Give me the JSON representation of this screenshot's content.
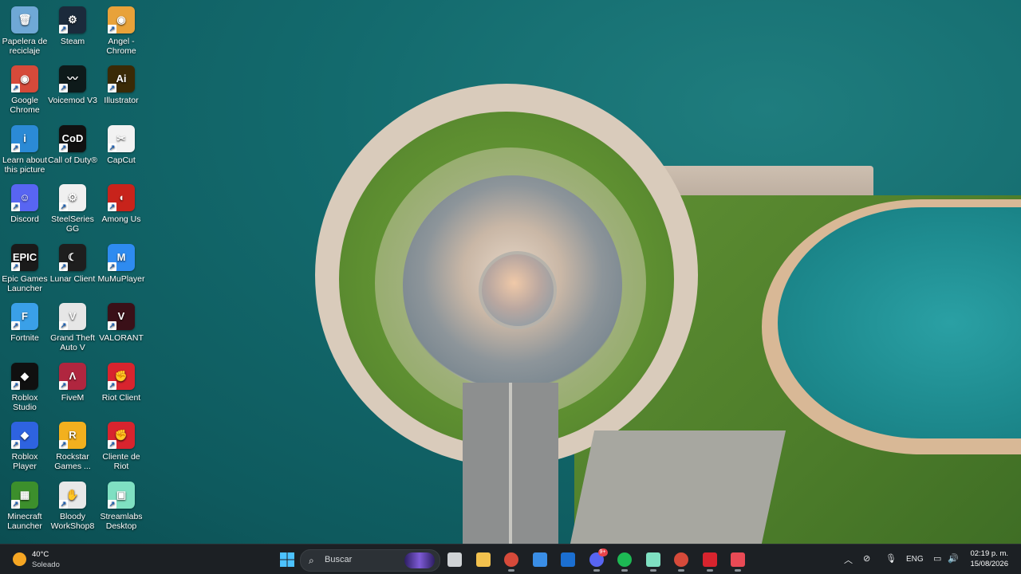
{
  "desktop": {
    "icons": [
      {
        "label": "Papelera de reciclaje",
        "glyph": "🗑",
        "color": "#6fa8d6"
      },
      {
        "label": "Steam",
        "glyph": "⚙",
        "color": "#1b2a3b"
      },
      {
        "label": "Angel - Chrome",
        "glyph": "◉",
        "color": "#e8a23a"
      },
      {
        "label": "Google Chrome",
        "glyph": "◉",
        "color": "#d64a3a"
      },
      {
        "label": "Voicemod V3",
        "glyph": "〰",
        "color": "#0e1a1a"
      },
      {
        "label": "Illustrator",
        "glyph": "Ai",
        "color": "#3a2a06"
      },
      {
        "label": "Learn about this picture",
        "glyph": "i",
        "color": "#2b8ad6"
      },
      {
        "label": "Call of Duty®",
        "glyph": "CoD",
        "color": "#111111"
      },
      {
        "label": "CapCut",
        "glyph": "✂",
        "color": "#f2f2f2"
      },
      {
        "label": "Discord",
        "glyph": "☺",
        "color": "#5865f2"
      },
      {
        "label": "SteelSeries GG",
        "glyph": "⚙",
        "color": "#f0f0f0"
      },
      {
        "label": "Among Us",
        "glyph": "◖",
        "color": "#c8231b"
      },
      {
        "label": "Epic Games Launcher",
        "glyph": "EPIC",
        "color": "#1a1a1a"
      },
      {
        "label": "Lunar Client",
        "glyph": "☾",
        "color": "#1e1e1e"
      },
      {
        "label": "MuMuPlayer",
        "glyph": "M",
        "color": "#2e8bf0"
      },
      {
        "label": "Fortnite",
        "glyph": "F",
        "color": "#3aa0e8"
      },
      {
        "label": "Grand Theft Auto V",
        "glyph": "V",
        "color": "#e6e6e6"
      },
      {
        "label": "VALORANT",
        "glyph": "V",
        "color": "#3a1018"
      },
      {
        "label": "Roblox Studio",
        "glyph": "◆",
        "color": "#101010"
      },
      {
        "label": "FiveM",
        "glyph": "Λ",
        "color": "#b0263f"
      },
      {
        "label": "Riot Client",
        "glyph": "✊",
        "color": "#d8242e"
      },
      {
        "label": "Roblox Player",
        "glyph": "◆",
        "color": "#2e63e0"
      },
      {
        "label": "Rockstar Games ...",
        "glyph": "R",
        "color": "#f2b01e"
      },
      {
        "label": "Cliente de Riot",
        "glyph": "✊",
        "color": "#d8242e"
      },
      {
        "label": "Minecraft Launcher",
        "glyph": "▦",
        "color": "#3c8f2c"
      },
      {
        "label": "Bloody WorkShop8",
        "glyph": "✋",
        "color": "#e8e8e8"
      },
      {
        "label": "Streamlabs Desktop",
        "glyph": "▣",
        "color": "#7fe0c2"
      }
    ]
  },
  "taskbar": {
    "weather": {
      "temp": "40°C",
      "condition": "Soleado"
    },
    "search_placeholder": "Buscar",
    "apps": [
      {
        "name": "task-view",
        "color": "#cfd3d6"
      },
      {
        "name": "file-explorer",
        "color": "#f2c14e"
      },
      {
        "name": "chrome",
        "color": "#d64a3a"
      },
      {
        "name": "microsoft-store",
        "color": "#3a8ee6"
      },
      {
        "name": "outlook",
        "color": "#1b6fd1"
      },
      {
        "name": "discord",
        "color": "#5865f2"
      },
      {
        "name": "spotify",
        "color": "#1db954"
      },
      {
        "name": "streamlabs",
        "color": "#7fe0c2"
      },
      {
        "name": "chrome-profile",
        "color": "#d64a3a"
      },
      {
        "name": "riot-client",
        "color": "#d8242e"
      },
      {
        "name": "valorant",
        "color": "#e84a55"
      }
    ],
    "discord_badge": "9+",
    "tray": {
      "language": "ENG",
      "time": "02:19 p. m.",
      "date": "15/08/2026"
    }
  }
}
